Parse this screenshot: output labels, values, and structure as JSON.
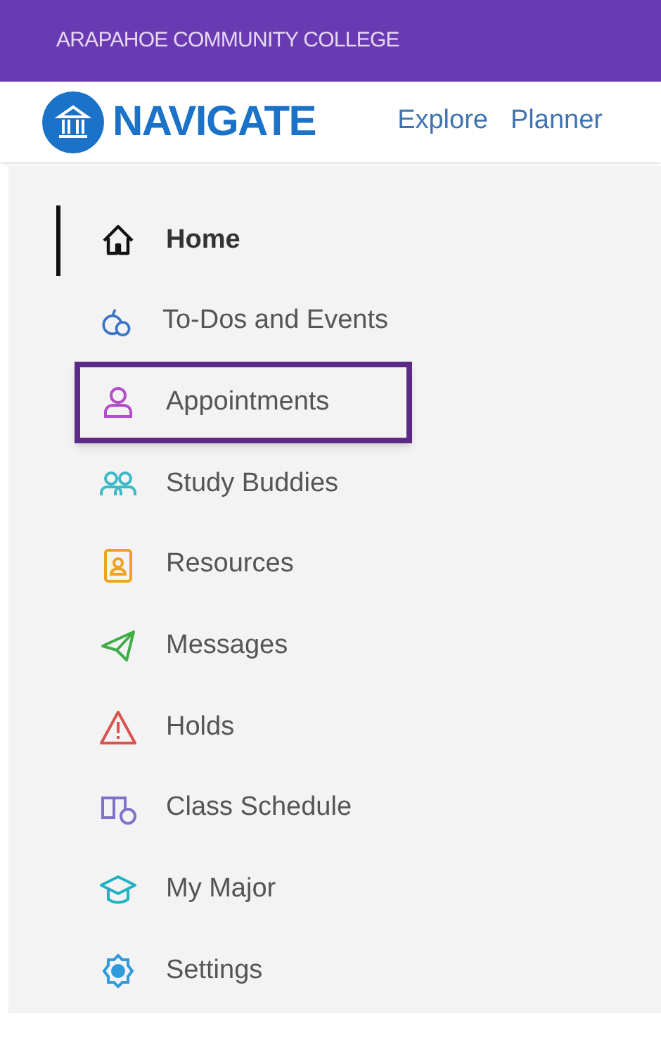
{
  "banner": {
    "title": "ARAPAHOE COMMUNITY COLLEGE"
  },
  "header": {
    "logo_text": "NAVIGATE",
    "links": [
      {
        "label": "Explore"
      },
      {
        "label": "Planner"
      }
    ]
  },
  "sidebar": {
    "items": [
      {
        "label": "Home",
        "kind": "home",
        "selected": true,
        "highlighted": false
      },
      {
        "label": "To-Dos and Events",
        "kind": "todos",
        "selected": false,
        "highlighted": false
      },
      {
        "label": "Appointments",
        "kind": "person",
        "selected": false,
        "highlighted": true
      },
      {
        "label": "Study Buddies",
        "kind": "people",
        "selected": false,
        "highlighted": false
      },
      {
        "label": "Resources",
        "kind": "resources",
        "selected": false,
        "highlighted": false
      },
      {
        "label": "Messages",
        "kind": "send",
        "selected": false,
        "highlighted": false
      },
      {
        "label": "Holds",
        "kind": "warning",
        "selected": false,
        "highlighted": false
      },
      {
        "label": "Class Schedule",
        "kind": "schedule",
        "selected": false,
        "highlighted": false
      },
      {
        "label": "My Major",
        "kind": "cap",
        "selected": false,
        "highlighted": false
      },
      {
        "label": "Settings",
        "kind": "gear",
        "selected": false,
        "highlighted": false
      }
    ]
  }
}
